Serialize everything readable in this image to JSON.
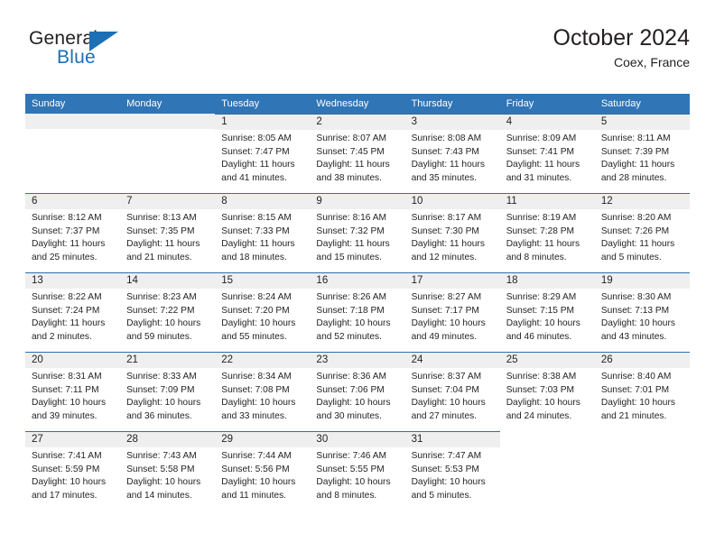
{
  "brand": {
    "name_top": "General",
    "name_bottom": "Blue",
    "flag_icon": "blue-triangle-flag",
    "accent_color": "#1b6fb5"
  },
  "header": {
    "title": "October 2024",
    "subtitle": "Coex, France"
  },
  "theme": {
    "header_bg": "#3075b6",
    "date_band_bg": "#efefef",
    "row_rule": "#2f6fab",
    "text": "#231f20"
  },
  "calendar": {
    "weekday_headers": [
      "Sunday",
      "Monday",
      "Tuesday",
      "Wednesday",
      "Thursday",
      "Friday",
      "Saturday"
    ],
    "weeks": [
      [
        {
          "day": "",
          "state": "empty",
          "lines": []
        },
        {
          "day": "",
          "state": "empty",
          "lines": []
        },
        {
          "day": "1",
          "state": "filled",
          "lines": [
            "Sunrise: 8:05 AM",
            "Sunset: 7:47 PM",
            "Daylight: 11 hours and 41 minutes."
          ]
        },
        {
          "day": "2",
          "state": "filled",
          "lines": [
            "Sunrise: 8:07 AM",
            "Sunset: 7:45 PM",
            "Daylight: 11 hours and 38 minutes."
          ]
        },
        {
          "day": "3",
          "state": "filled",
          "lines": [
            "Sunrise: 8:08 AM",
            "Sunset: 7:43 PM",
            "Daylight: 11 hours and 35 minutes."
          ]
        },
        {
          "day": "4",
          "state": "filled",
          "lines": [
            "Sunrise: 8:09 AM",
            "Sunset: 7:41 PM",
            "Daylight: 11 hours and 31 minutes."
          ]
        },
        {
          "day": "5",
          "state": "filled",
          "lines": [
            "Sunrise: 8:11 AM",
            "Sunset: 7:39 PM",
            "Daylight: 11 hours and 28 minutes."
          ]
        }
      ],
      [
        {
          "day": "6",
          "state": "filled",
          "lines": [
            "Sunrise: 8:12 AM",
            "Sunset: 7:37 PM",
            "Daylight: 11 hours and 25 minutes."
          ]
        },
        {
          "day": "7",
          "state": "filled",
          "lines": [
            "Sunrise: 8:13 AM",
            "Sunset: 7:35 PM",
            "Daylight: 11 hours and 21 minutes."
          ]
        },
        {
          "day": "8",
          "state": "filled",
          "lines": [
            "Sunrise: 8:15 AM",
            "Sunset: 7:33 PM",
            "Daylight: 11 hours and 18 minutes."
          ]
        },
        {
          "day": "9",
          "state": "filled",
          "lines": [
            "Sunrise: 8:16 AM",
            "Sunset: 7:32 PM",
            "Daylight: 11 hours and 15 minutes."
          ]
        },
        {
          "day": "10",
          "state": "filled",
          "lines": [
            "Sunrise: 8:17 AM",
            "Sunset: 7:30 PM",
            "Daylight: 11 hours and 12 minutes."
          ]
        },
        {
          "day": "11",
          "state": "filled",
          "lines": [
            "Sunrise: 8:19 AM",
            "Sunset: 7:28 PM",
            "Daylight: 11 hours and 8 minutes."
          ]
        },
        {
          "day": "12",
          "state": "filled",
          "lines": [
            "Sunrise: 8:20 AM",
            "Sunset: 7:26 PM",
            "Daylight: 11 hours and 5 minutes."
          ]
        }
      ],
      [
        {
          "day": "13",
          "state": "filled",
          "lines": [
            "Sunrise: 8:22 AM",
            "Sunset: 7:24 PM",
            "Daylight: 11 hours and 2 minutes."
          ]
        },
        {
          "day": "14",
          "state": "filled",
          "lines": [
            "Sunrise: 8:23 AM",
            "Sunset: 7:22 PM",
            "Daylight: 10 hours and 59 minutes."
          ]
        },
        {
          "day": "15",
          "state": "filled",
          "lines": [
            "Sunrise: 8:24 AM",
            "Sunset: 7:20 PM",
            "Daylight: 10 hours and 55 minutes."
          ]
        },
        {
          "day": "16",
          "state": "filled",
          "lines": [
            "Sunrise: 8:26 AM",
            "Sunset: 7:18 PM",
            "Daylight: 10 hours and 52 minutes."
          ]
        },
        {
          "day": "17",
          "state": "filled",
          "lines": [
            "Sunrise: 8:27 AM",
            "Sunset: 7:17 PM",
            "Daylight: 10 hours and 49 minutes."
          ]
        },
        {
          "day": "18",
          "state": "filled",
          "lines": [
            "Sunrise: 8:29 AM",
            "Sunset: 7:15 PM",
            "Daylight: 10 hours and 46 minutes."
          ]
        },
        {
          "day": "19",
          "state": "filled",
          "lines": [
            "Sunrise: 8:30 AM",
            "Sunset: 7:13 PM",
            "Daylight: 10 hours and 43 minutes."
          ]
        }
      ],
      [
        {
          "day": "20",
          "state": "filled",
          "lines": [
            "Sunrise: 8:31 AM",
            "Sunset: 7:11 PM",
            "Daylight: 10 hours and 39 minutes."
          ]
        },
        {
          "day": "21",
          "state": "filled",
          "lines": [
            "Sunrise: 8:33 AM",
            "Sunset: 7:09 PM",
            "Daylight: 10 hours and 36 minutes."
          ]
        },
        {
          "day": "22",
          "state": "filled",
          "lines": [
            "Sunrise: 8:34 AM",
            "Sunset: 7:08 PM",
            "Daylight: 10 hours and 33 minutes."
          ]
        },
        {
          "day": "23",
          "state": "filled",
          "lines": [
            "Sunrise: 8:36 AM",
            "Sunset: 7:06 PM",
            "Daylight: 10 hours and 30 minutes."
          ]
        },
        {
          "day": "24",
          "state": "filled",
          "lines": [
            "Sunrise: 8:37 AM",
            "Sunset: 7:04 PM",
            "Daylight: 10 hours and 27 minutes."
          ]
        },
        {
          "day": "25",
          "state": "filled",
          "lines": [
            "Sunrise: 8:38 AM",
            "Sunset: 7:03 PM",
            "Daylight: 10 hours and 24 minutes."
          ]
        },
        {
          "day": "26",
          "state": "filled",
          "lines": [
            "Sunrise: 8:40 AM",
            "Sunset: 7:01 PM",
            "Daylight: 10 hours and 21 minutes."
          ]
        }
      ],
      [
        {
          "day": "27",
          "state": "filled",
          "lines": [
            "Sunrise: 7:41 AM",
            "Sunset: 5:59 PM",
            "Daylight: 10 hours and 17 minutes."
          ]
        },
        {
          "day": "28",
          "state": "filled",
          "lines": [
            "Sunrise: 7:43 AM",
            "Sunset: 5:58 PM",
            "Daylight: 10 hours and 14 minutes."
          ]
        },
        {
          "day": "29",
          "state": "filled",
          "lines": [
            "Sunrise: 7:44 AM",
            "Sunset: 5:56 PM",
            "Daylight: 10 hours and 11 minutes."
          ]
        },
        {
          "day": "30",
          "state": "filled",
          "lines": [
            "Sunrise: 7:46 AM",
            "Sunset: 5:55 PM",
            "Daylight: 10 hours and 8 minutes."
          ]
        },
        {
          "day": "31",
          "state": "filled",
          "lines": [
            "Sunrise: 7:47 AM",
            "Sunset: 5:53 PM",
            "Daylight: 10 hours and 5 minutes."
          ]
        },
        {
          "day": "",
          "state": "blank",
          "lines": []
        },
        {
          "day": "",
          "state": "blank",
          "lines": []
        }
      ]
    ]
  }
}
